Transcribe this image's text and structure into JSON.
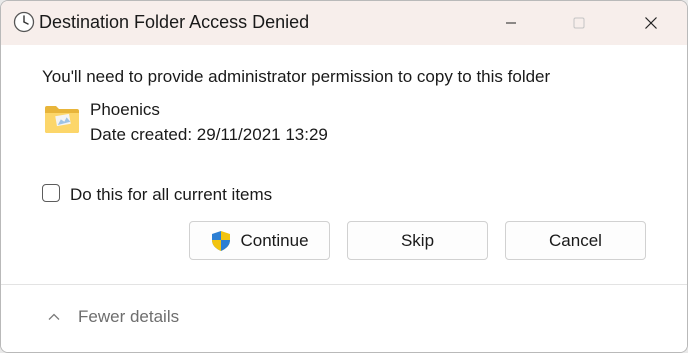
{
  "window": {
    "title": "Destination Folder Access Denied",
    "controls": {
      "minimize_icon": "minimize-icon",
      "maximize_icon": "maximize-icon",
      "close_icon": "close-icon"
    }
  },
  "main": {
    "message": "You'll need to provide administrator permission to copy to this folder",
    "folder": {
      "name": "Phoenics",
      "date_created": "Date created: 29/11/2021 13:29",
      "icon": "folder-icon"
    },
    "checkbox": {
      "label": "Do this for all current items",
      "checked": false
    }
  },
  "buttons": {
    "continue_label": "Continue",
    "skip_label": "Skip",
    "cancel_label": "Cancel"
  },
  "footer": {
    "details_label": "Fewer details"
  },
  "colors": {
    "titlebar_bg": "#f7eeeb",
    "dialog_bg": "#ffffff",
    "text": "#1a1a1a",
    "muted_text": "#6e6e6e"
  }
}
